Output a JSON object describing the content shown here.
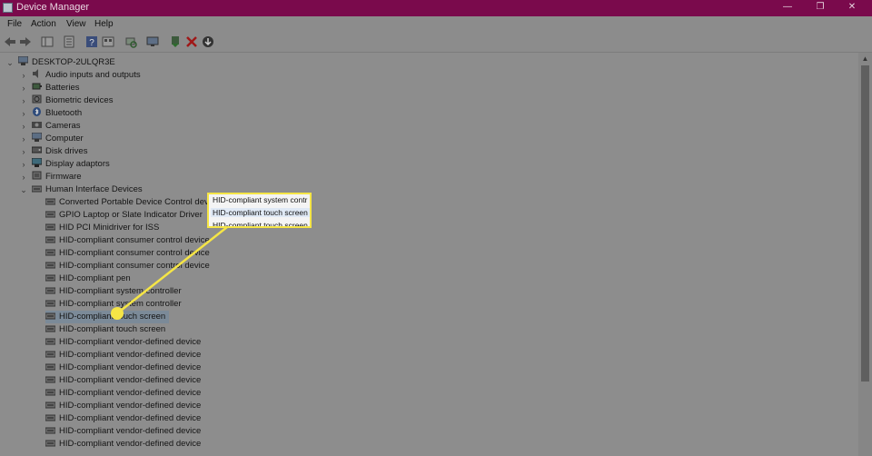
{
  "window": {
    "title": "Device Manager",
    "minimize_glyph": "—",
    "maximize_glyph": "❐",
    "close_glyph": "✕"
  },
  "menu": {
    "file": "File",
    "action": "Action",
    "view": "View",
    "help": "Help"
  },
  "tree": {
    "root": "DESKTOP-2ULQR3E",
    "categories": [
      "Audio inputs and outputs",
      "Batteries",
      "Biometric devices",
      "Bluetooth",
      "Cameras",
      "Computer",
      "Disk drives",
      "Display adaptors",
      "Firmware",
      "Human Interface Devices"
    ],
    "hid_devices": [
      "Converted Portable Device Control device",
      "GPIO Laptop or Slate Indicator Driver",
      "HID PCI Minidriver for ISS",
      "HID-compliant consumer control device",
      "HID-compliant consumer control device",
      "HID-compliant consumer control device",
      "HID-compliant pen",
      "HID-compliant system controller",
      "HID-compliant system controller",
      "HID-compliant touch screen",
      "HID-compliant touch screen",
      "HID-compliant vendor-defined device",
      "HID-compliant vendor-defined device",
      "HID-compliant vendor-defined device",
      "HID-compliant vendor-defined device",
      "HID-compliant vendor-defined device",
      "HID-compliant vendor-defined device",
      "HID-compliant vendor-defined device",
      "HID-compliant vendor-defined device",
      "HID-compliant vendor-defined device"
    ]
  },
  "callout": {
    "line1": "HID-compliant system contr",
    "line2": "HID-compliant touch screen",
    "line3": "HID-compliant touch screen"
  },
  "colors": {
    "titlebar": "#7a0a4c",
    "highlight": "#f5e546",
    "dim_background": "#8d8d8d"
  }
}
